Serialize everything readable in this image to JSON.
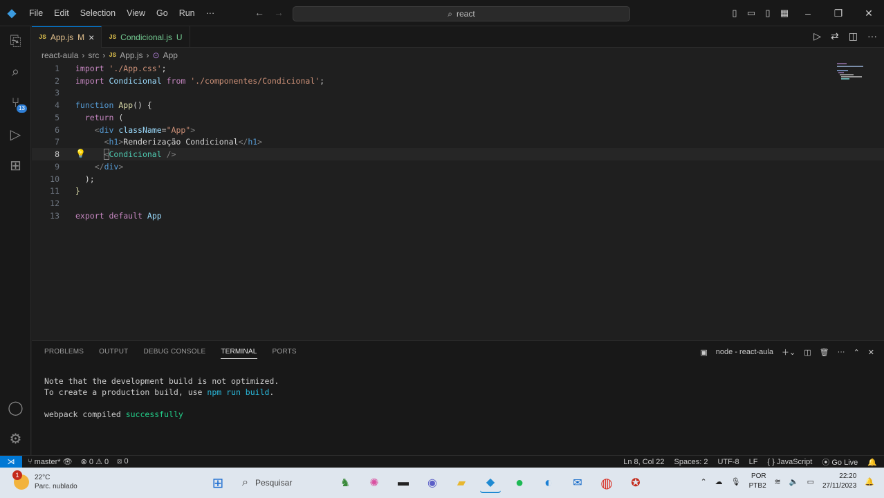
{
  "menu": [
    "File",
    "Edit",
    "Selection",
    "View",
    "Go",
    "Run",
    "···"
  ],
  "command_center": {
    "text": "react"
  },
  "tabs": [
    {
      "name": "App.js",
      "status": "M",
      "close": "×"
    },
    {
      "name": "Condicional.js",
      "status": "U"
    }
  ],
  "breadcrumb": [
    "react-aula",
    "src",
    "App.js",
    "App"
  ],
  "code": {
    "l1": {
      "n": "1",
      "a": "import",
      "b": "'./App.css'",
      "c": ";"
    },
    "l2": {
      "n": "2",
      "a": "import",
      "b": "Condicional",
      "c": "from",
      "d": "'./componentes/Condicional'",
      "e": ";"
    },
    "l3": {
      "n": "3"
    },
    "l4": {
      "n": "4",
      "a": "function",
      "b": "App",
      "c": "() {"
    },
    "l5": {
      "n": "5",
      "a": "return",
      "b": " ("
    },
    "l6": {
      "n": "6",
      "a": "<",
      "b": "div",
      "c": "className",
      "d": "=",
      "e": "\"App\"",
      "f": ">"
    },
    "l7": {
      "n": "7",
      "a": "<",
      "b": "h1",
      "c": ">",
      "d": "Renderização Condicional",
      "e": "</",
      "f": "h1",
      "g": ">"
    },
    "l8": {
      "n": "8",
      "a": "<",
      "b": "Condicional",
      "c": " />"
    },
    "l9": {
      "n": "9",
      "a": "</",
      "b": "div",
      "c": ">"
    },
    "l10": {
      "n": "10",
      "a": ");"
    },
    "l11": {
      "n": "11",
      "a": "}"
    },
    "l12": {
      "n": "12"
    },
    "l13": {
      "n": "13",
      "a": "export",
      "b": "default",
      "c": "App"
    }
  },
  "panel": {
    "tabs": [
      "PROBLEMS",
      "OUTPUT",
      "DEBUG CONSOLE",
      "TERMINAL",
      "PORTS"
    ],
    "terminal_name": "node - react-aula",
    "lines": {
      "l1": "Note that the development build is not optimized.",
      "l2a": "To create a production build, use ",
      "l2b": "npm run build",
      "l2c": ".",
      "l3a": "webpack compiled ",
      "l3b": "successfully"
    }
  },
  "status": {
    "branch": "master*",
    "errors": "0",
    "warnings": "0",
    "ports": "0",
    "position": "Ln 8, Col 22",
    "spaces": "Spaces: 2",
    "encoding": "UTF-8",
    "eol": "LF",
    "language": "JavaScript",
    "golive": "Go Live"
  },
  "taskbar": {
    "weather_temp": "22°C",
    "weather_desc": "Parc. nublado",
    "weather_badge": "1",
    "search_placeholder": "Pesquisar",
    "lang": "POR",
    "layout": "PTB2",
    "time": "22:20",
    "date": "27/11/2023"
  },
  "activity_badge": "13"
}
